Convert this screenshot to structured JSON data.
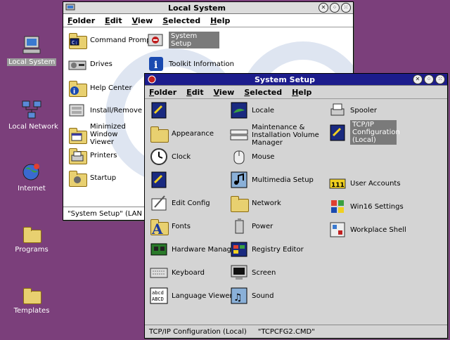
{
  "desktop": {
    "icons": [
      {
        "label": "Local System",
        "icon": "computer-icon"
      },
      {
        "label": "Local Network",
        "icon": "network-icon"
      },
      {
        "label": "Internet",
        "icon": "globe-icon"
      },
      {
        "label": "Programs",
        "icon": "programs-folder-icon"
      },
      {
        "label": "Templates",
        "icon": "templates-folder-icon"
      }
    ]
  },
  "local_system": {
    "title": "Local System",
    "menu": [
      "Folder",
      "Edit",
      "View",
      "Selected",
      "Help"
    ],
    "items": [
      {
        "label": "Command Prompts"
      },
      {
        "label": "Drives"
      },
      {
        "label": "Help Center"
      },
      {
        "label": "Install/Remove"
      },
      {
        "label": "Minimized Window Viewer"
      },
      {
        "label": "Printers"
      },
      {
        "label": "Startup"
      },
      {
        "label": "System Setup"
      },
      {
        "label": "Toolkit Information"
      }
    ],
    "status": "\"System Setup\" (LAN Server"
  },
  "system_setup": {
    "title": "System Setup",
    "menu": [
      "Folder",
      "Edit",
      "View",
      "Selected",
      "Help"
    ],
    "col1": [
      {
        "label": ""
      },
      {
        "label": "Appearance"
      },
      {
        "label": "Clock"
      },
      {
        "label": ""
      },
      {
        "label": "Edit Config"
      },
      {
        "label": "Fonts"
      },
      {
        "label": "Hardware Manager"
      },
      {
        "label": "Keyboard"
      },
      {
        "label": "Language Viewer"
      }
    ],
    "col2": [
      {
        "label": "Locale"
      },
      {
        "label": "Maintenance & Installation Volume Manager"
      },
      {
        "label": "Mouse"
      },
      {
        "label": "Multimedia Setup"
      },
      {
        "label": "Network"
      },
      {
        "label": "Power"
      },
      {
        "label": "Registry Editor"
      },
      {
        "label": "Screen"
      },
      {
        "label": "Sound"
      }
    ],
    "col3": [
      {
        "label": "Spooler"
      },
      {
        "label": "TCP/IP Configuration (Local)"
      },
      {
        "label": "User Accounts"
      },
      {
        "label": "Win16 Settings"
      },
      {
        "label": "Workplace Shell"
      }
    ],
    "status_left": "TCP/IP Configuration (Local)",
    "status_right": "\"TCPCFG2.CMD\""
  },
  "colors": {
    "desktop": "#7b3f7b",
    "titlebar_active": "#1c1c8c",
    "titlebar_inactive": "#dcdcdc"
  }
}
